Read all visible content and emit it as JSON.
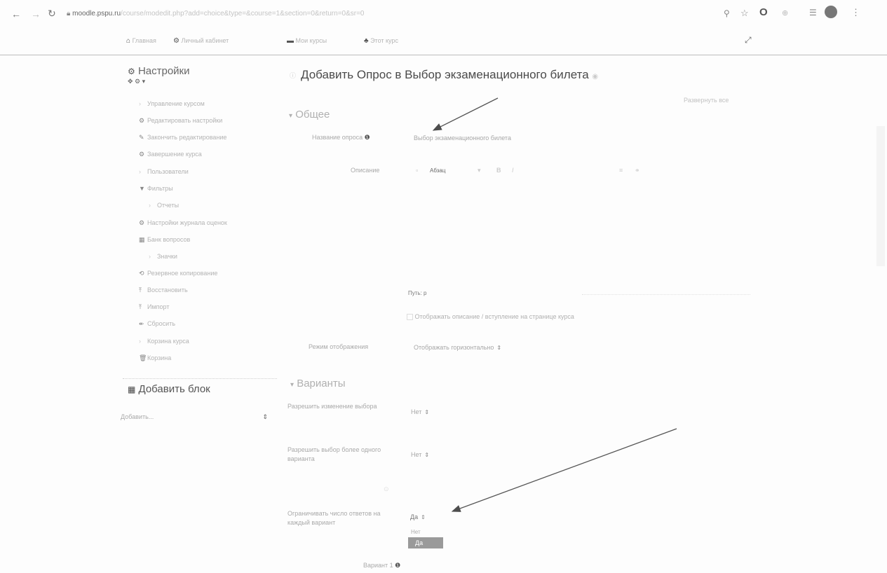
{
  "browser": {
    "url_host": "moodle.pspu.ru",
    "url_rest": "/course/modedit.php?add=choice&type=&course=1&section=0&return=0&sr=0"
  },
  "navbar": {
    "items": [
      {
        "label": "Главная",
        "icon": "home-icon"
      },
      {
        "label": "Личный кабинет",
        "icon": "dashboard-icon"
      },
      {
        "label": "Мои курсы",
        "icon": "courses-icon"
      },
      {
        "label": "Этот курс",
        "icon": "sitemap-icon"
      }
    ]
  },
  "sidebar": {
    "title": "Настройки",
    "items": [
      {
        "label": "Управление курсом",
        "icon": "",
        "indent": 0
      },
      {
        "label": "Редактировать настройки",
        "icon": "gear-icon",
        "indent": 0
      },
      {
        "label": "Закончить редактирование",
        "icon": "pencil-icon",
        "indent": 0
      },
      {
        "label": "Завершение курса",
        "icon": "gear-icon",
        "indent": 0
      },
      {
        "label": "Пользователи",
        "icon": "",
        "indent": 0
      },
      {
        "label": "Фильтры",
        "icon": "filter-icon",
        "indent": 0
      },
      {
        "label": "Отчеты",
        "icon": "",
        "indent": 1
      },
      {
        "label": "Настройки журнала оценок",
        "icon": "gear-icon",
        "indent": 0
      },
      {
        "label": "Банк вопросов",
        "icon": "table-icon",
        "indent": 0
      },
      {
        "label": "Значки",
        "icon": "",
        "indent": 1
      },
      {
        "label": "Резервное копирование",
        "icon": "backup-icon",
        "indent": 0
      },
      {
        "label": "Восстановить",
        "icon": "restore-icon",
        "indent": 0
      },
      {
        "label": "Импорт",
        "icon": "import-icon",
        "indent": 0
      },
      {
        "label": "Сбросить",
        "icon": "reset-icon",
        "indent": 0
      },
      {
        "label": "Корзина курса",
        "icon": "",
        "indent": 0
      },
      {
        "label": "Корзина",
        "icon": "trash-icon",
        "indent": 0
      }
    ],
    "add_block_title": "Добавить блок",
    "add_block_select": "Добавить..."
  },
  "main": {
    "title": "Добавить Опрос в Выбор экзаменационного билета",
    "expand_all": "Развернуть все",
    "section_general": "Общее",
    "field_name_label": "Название опроса",
    "field_name_value": "Выбор экзаменационного билета",
    "field_description_label": "Описание",
    "editor_para": "Абзац",
    "path_label": "Путь: p",
    "show_description": "Отображать описание / вступление на странице курса",
    "display_mode_label": "Режим отображения",
    "display_mode_value": "Отображать горизонтально",
    "section_options": "Варианты",
    "allow_update_label": "Разрешить изменение выбора",
    "allow_update_value": "Нет",
    "allow_multiple_label": "Разрешить выбор более одного варианта",
    "allow_multiple_value": "Нет",
    "limit_label": "Ограничивать число ответов на каждый вариант",
    "limit_value": "Да",
    "limit_option_no": "Нет",
    "limit_option_yes": "Да",
    "option_label": "Вариант 1"
  }
}
